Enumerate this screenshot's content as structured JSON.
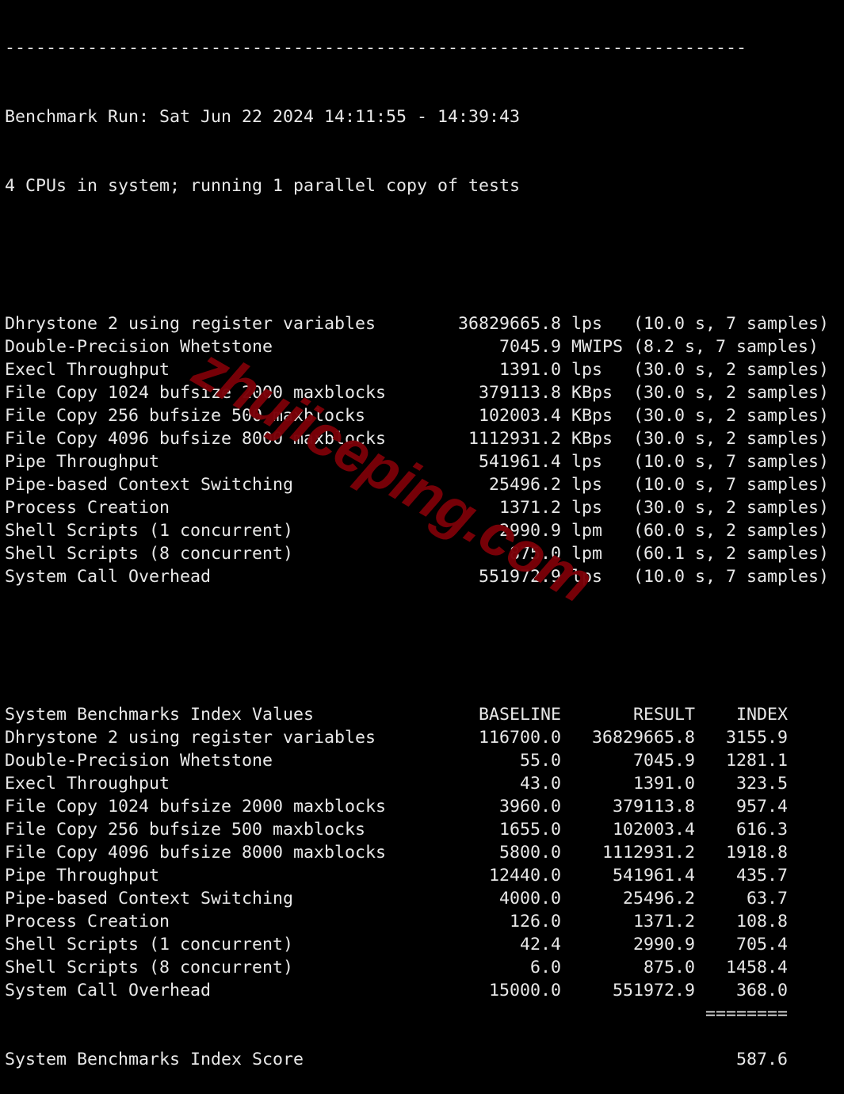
{
  "header": {
    "separator": "------------------------------------------------------------------------",
    "run_line": "Benchmark Run: Sat Jun 22 2024 14:11:55 - 14:39:43",
    "cpu_line": "4 CPUs in system; running 1 parallel copy of tests"
  },
  "results": [
    {
      "name": "Dhrystone 2 using register variables",
      "value": "36829665.8",
      "unit": "lps",
      "detail": "(10.0 s, 7 samples)"
    },
    {
      "name": "Double-Precision Whetstone",
      "value": "7045.9",
      "unit": "MWIPS",
      "detail": "(8.2 s, 7 samples)"
    },
    {
      "name": "Execl Throughput",
      "value": "1391.0",
      "unit": "lps",
      "detail": "(30.0 s, 2 samples)"
    },
    {
      "name": "File Copy 1024 bufsize 2000 maxblocks",
      "value": "379113.8",
      "unit": "KBps",
      "detail": "(30.0 s, 2 samples)"
    },
    {
      "name": "File Copy 256 bufsize 500 maxblocks",
      "value": "102003.4",
      "unit": "KBps",
      "detail": "(30.0 s, 2 samples)"
    },
    {
      "name": "File Copy 4096 bufsize 8000 maxblocks",
      "value": "1112931.2",
      "unit": "KBps",
      "detail": "(30.0 s, 2 samples)"
    },
    {
      "name": "Pipe Throughput",
      "value": "541961.4",
      "unit": "lps",
      "detail": "(10.0 s, 7 samples)"
    },
    {
      "name": "Pipe-based Context Switching",
      "value": "25496.2",
      "unit": "lps",
      "detail": "(10.0 s, 7 samples)"
    },
    {
      "name": "Process Creation",
      "value": "1371.2",
      "unit": "lps",
      "detail": "(30.0 s, 2 samples)"
    },
    {
      "name": "Shell Scripts (1 concurrent)",
      "value": "2990.9",
      "unit": "lpm",
      "detail": "(60.0 s, 2 samples)"
    },
    {
      "name": "Shell Scripts (8 concurrent)",
      "value": "875.0",
      "unit": "lpm",
      "detail": "(60.1 s, 2 samples)"
    },
    {
      "name": "System Call Overhead",
      "value": "551972.9",
      "unit": "lps",
      "detail": "(10.0 s, 7 samples)"
    }
  ],
  "index": {
    "title": "System Benchmarks Index Values",
    "headers": [
      "BASELINE",
      "RESULT",
      "INDEX"
    ],
    "rows": [
      {
        "name": "Dhrystone 2 using register variables",
        "baseline": "116700.0",
        "result": "36829665.8",
        "index": "3155.9"
      },
      {
        "name": "Double-Precision Whetstone",
        "baseline": "55.0",
        "result": "7045.9",
        "index": "1281.1"
      },
      {
        "name": "Execl Throughput",
        "baseline": "43.0",
        "result": "1391.0",
        "index": "323.5"
      },
      {
        "name": "File Copy 1024 bufsize 2000 maxblocks",
        "baseline": "3960.0",
        "result": "379113.8",
        "index": "957.4"
      },
      {
        "name": "File Copy 256 bufsize 500 maxblocks",
        "baseline": "1655.0",
        "result": "102003.4",
        "index": "616.3"
      },
      {
        "name": "File Copy 4096 bufsize 8000 maxblocks",
        "baseline": "5800.0",
        "result": "1112931.2",
        "index": "1918.8"
      },
      {
        "name": "Pipe Throughput",
        "baseline": "12440.0",
        "result": "541961.4",
        "index": "435.7"
      },
      {
        "name": "Pipe-based Context Switching",
        "baseline": "4000.0",
        "result": "25496.2",
        "index": "63.7"
      },
      {
        "name": "Process Creation",
        "baseline": "126.0",
        "result": "1371.2",
        "index": "108.8"
      },
      {
        "name": "Shell Scripts (1 concurrent)",
        "baseline": "42.4",
        "result": "2990.9",
        "index": "705.4"
      },
      {
        "name": "Shell Scripts (8 concurrent)",
        "baseline": "6.0",
        "result": "875.0",
        "index": "1458.4"
      },
      {
        "name": "System Call Overhead",
        "baseline": "15000.0",
        "result": "551972.9",
        "index": "368.0"
      }
    ],
    "total_rule": "========",
    "score_label": "System Benchmarks Index Score",
    "score": "587.6"
  },
  "watermark": "zhujiceping.com"
}
